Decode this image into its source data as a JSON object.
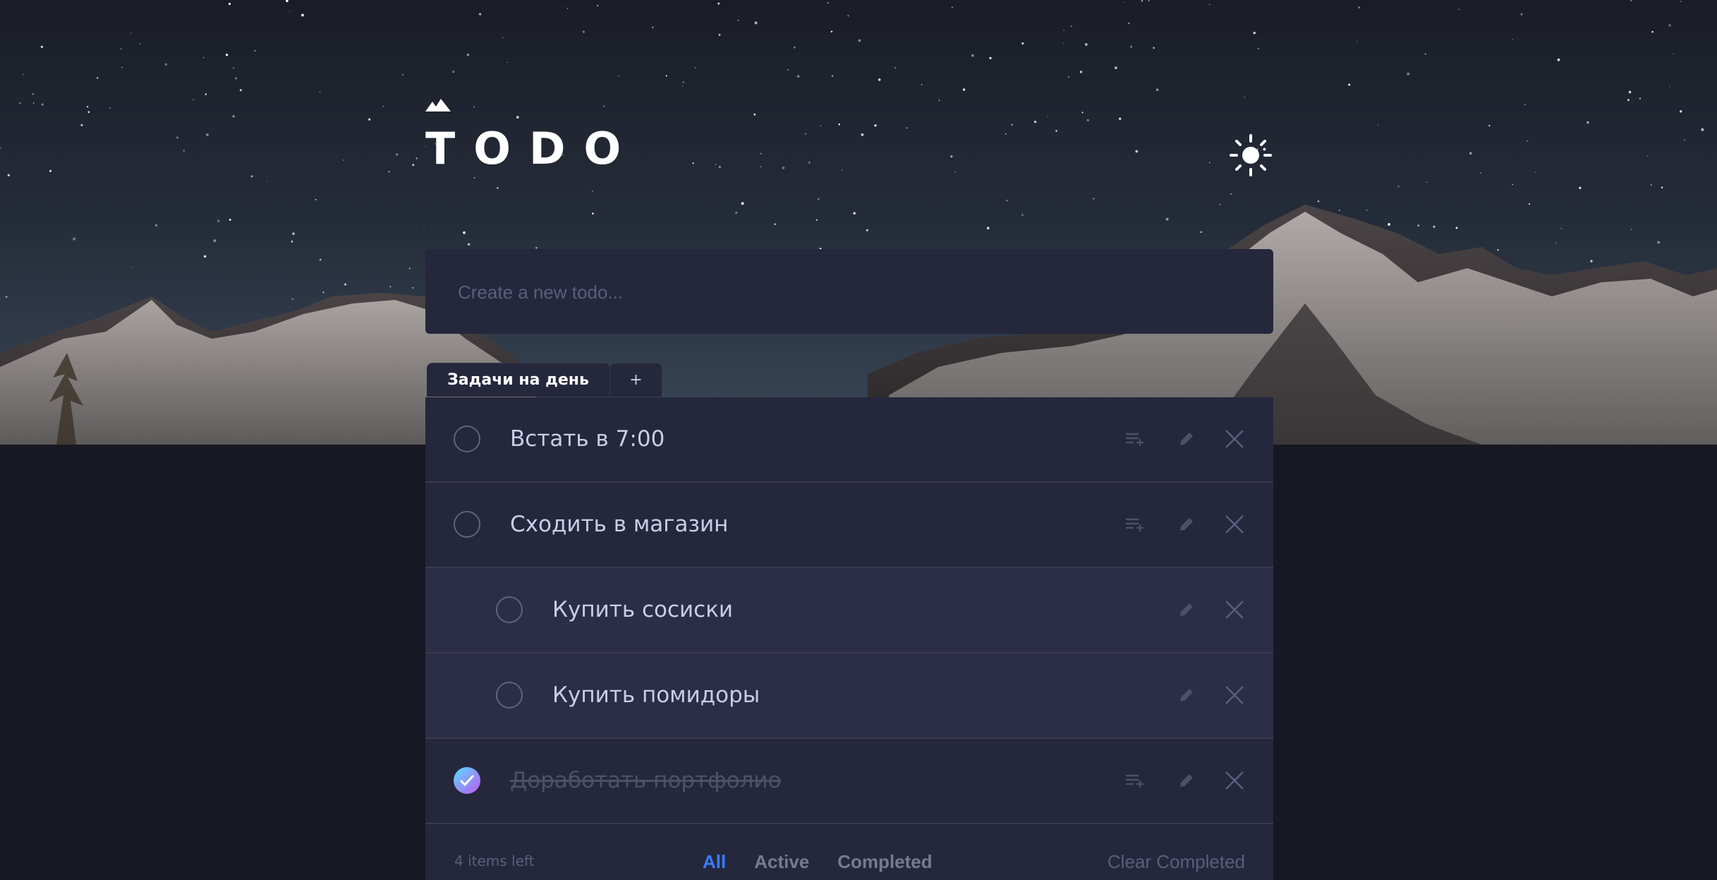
{
  "app": {
    "title": "TODO",
    "theme_icon": "sun-icon",
    "logo_icon": "mountain-icon"
  },
  "new_todo": {
    "placeholder": "Create a new todo..."
  },
  "tabs": [
    {
      "label": "Задачи на день",
      "active": true
    },
    {
      "label": "+",
      "active": false
    }
  ],
  "todos": [
    {
      "text": "Встать в 7:00",
      "completed": false,
      "subtask": false
    },
    {
      "text": "Сходить в магазин",
      "completed": false,
      "subtask": false
    },
    {
      "text": "Купить сосиски",
      "completed": false,
      "subtask": true
    },
    {
      "text": "Купить помидоры",
      "completed": false,
      "subtask": true
    },
    {
      "text": "Доработать портфолио",
      "completed": true,
      "subtask": false
    }
  ],
  "footer": {
    "items_left": "4 items left",
    "filters": [
      "All",
      "Active",
      "Completed"
    ],
    "active_filter": "All",
    "clear_label": "Clear Completed"
  },
  "colors": {
    "background": "#181824",
    "card": "#25273c",
    "subtask_row": "#2c2d46",
    "accent": "#3a7cfd",
    "check_gradient_start": "#57ddff",
    "check_gradient_end": "#c058f3"
  }
}
